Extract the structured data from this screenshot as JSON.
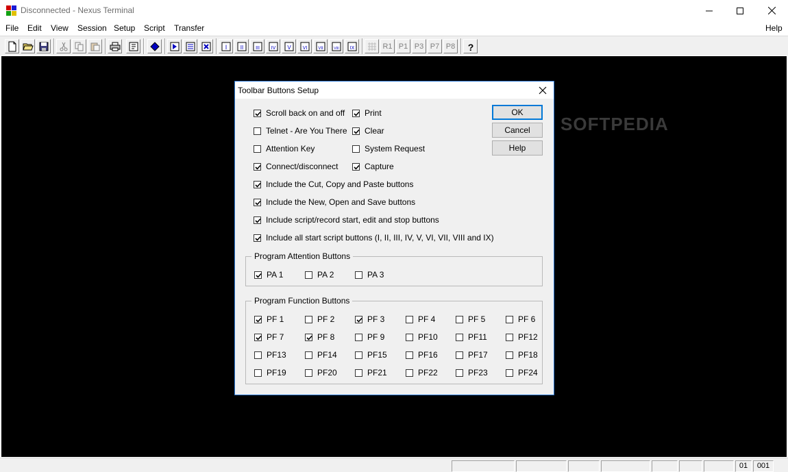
{
  "window": {
    "title": "Disconnected - Nexus Terminal"
  },
  "menu": {
    "file": "File",
    "edit": "Edit",
    "view": "View",
    "session": "Session",
    "setup": "Setup",
    "script": "Script",
    "transfer": "Transfer",
    "help": "Help"
  },
  "toolbar": {
    "r1": "R1",
    "r2": "P1",
    "r3": "P3",
    "r4": "P7",
    "r5": "P8"
  },
  "status": {
    "row": "01",
    "col": "001"
  },
  "watermark": "SOFTPEDIA",
  "dialog": {
    "title": "Toolbar Buttons Setup",
    "ok": "OK",
    "cancel": "Cancel",
    "help": "Help",
    "options": [
      {
        "label": "Scroll back on and off",
        "checked": true
      },
      {
        "label": "Print",
        "checked": true
      },
      {
        "label": "Telnet - Are You There",
        "checked": false
      },
      {
        "label": "Clear",
        "checked": true
      },
      {
        "label": "Attention Key",
        "checked": false
      },
      {
        "label": "System Request",
        "checked": false
      },
      {
        "label": "Connect/disconnect",
        "checked": true
      },
      {
        "label": "Capture",
        "checked": true
      },
      {
        "label": "Include the Cut, Copy and Paste buttons",
        "checked": true
      },
      {
        "label": "Include the New, Open and Save buttons",
        "checked": true
      },
      {
        "label": "Include script/record start, edit and stop buttons",
        "checked": true
      },
      {
        "label": "Include all start script buttons (I, II, III, IV, V, VI, VII, VIII and IX)",
        "checked": true
      }
    ],
    "pa_group": {
      "title": "Program Attention Buttons",
      "items": [
        {
          "label": "PA 1",
          "checked": true
        },
        {
          "label": "PA 2",
          "checked": false
        },
        {
          "label": "PA 3",
          "checked": false
        }
      ]
    },
    "pf_group": {
      "title": "Program Function Buttons",
      "items": [
        {
          "label": "PF 1",
          "checked": true
        },
        {
          "label": "PF 2",
          "checked": false
        },
        {
          "label": "PF 3",
          "checked": true
        },
        {
          "label": "PF 4",
          "checked": false
        },
        {
          "label": "PF 5",
          "checked": false
        },
        {
          "label": "PF 6",
          "checked": false
        },
        {
          "label": "PF 7",
          "checked": true
        },
        {
          "label": "PF 8",
          "checked": true
        },
        {
          "label": "PF 9",
          "checked": false
        },
        {
          "label": "PF10",
          "checked": false
        },
        {
          "label": "PF11",
          "checked": false
        },
        {
          "label": "PF12",
          "checked": false
        },
        {
          "label": "PF13",
          "checked": false
        },
        {
          "label": "PF14",
          "checked": false
        },
        {
          "label": "PF15",
          "checked": false
        },
        {
          "label": "PF16",
          "checked": false
        },
        {
          "label": "PF17",
          "checked": false
        },
        {
          "label": "PF18",
          "checked": false
        },
        {
          "label": "PF19",
          "checked": false
        },
        {
          "label": "PF20",
          "checked": false
        },
        {
          "label": "PF21",
          "checked": false
        },
        {
          "label": "PF22",
          "checked": false
        },
        {
          "label": "PF23",
          "checked": false
        },
        {
          "label": "PF24",
          "checked": false
        }
      ]
    }
  }
}
